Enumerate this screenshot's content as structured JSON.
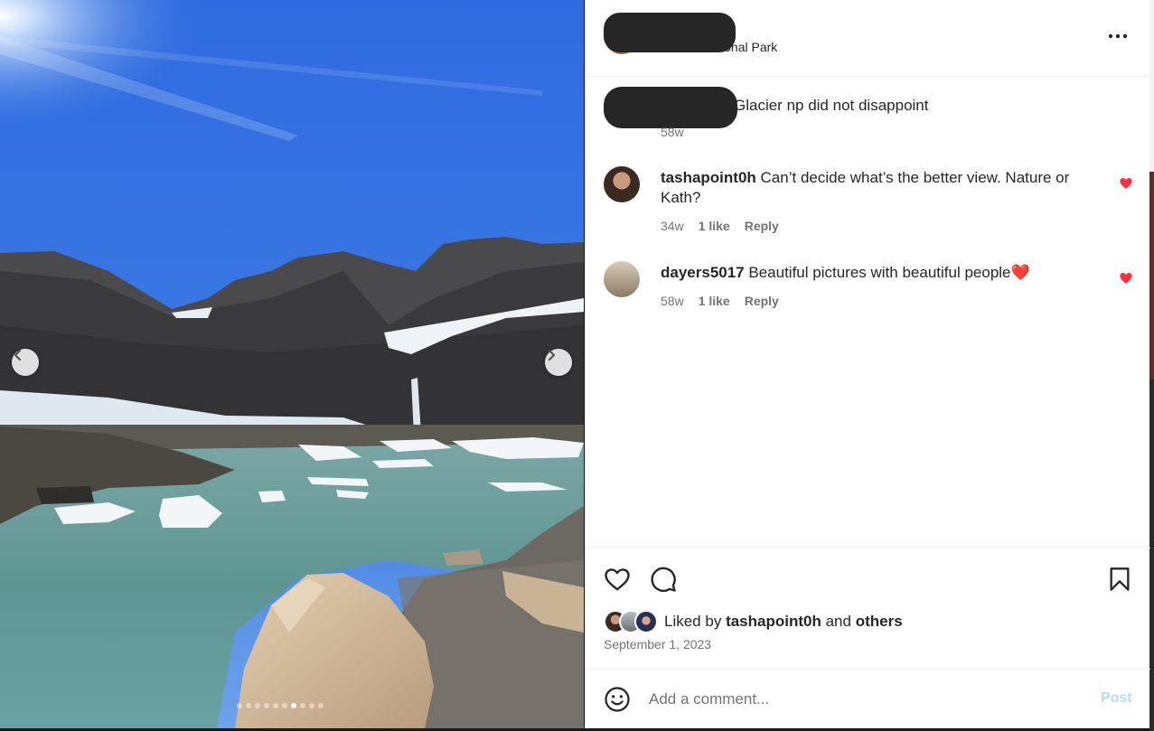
{
  "post": {
    "location": "Glacier National Park",
    "more_icon": "more-horizontal-icon"
  },
  "photo": {
    "alt": "Glacier lake with icebergs beneath mountain cliffs",
    "carousel_total": 10,
    "carousel_active": 7
  },
  "caption": {
    "text": "Glacier np did not disappoint",
    "time": "58w"
  },
  "comments": [
    {
      "username": "tashapoint0h",
      "text": "Can’t decide what’s the better view. Nature or Kath?",
      "time": "34w",
      "likes": "1 like",
      "reply": "Reply",
      "liked": true
    },
    {
      "username": "dayers5017",
      "text": "Beautiful pictures with beautiful people❤️",
      "time": "58w",
      "likes": "1 like",
      "reply": "Reply",
      "liked": true
    }
  ],
  "likes": {
    "prefix": "Liked by",
    "user": "tashapoint0h",
    "and": "and",
    "others": "others"
  },
  "date": "September 1, 2023",
  "add_comment": {
    "placeholder": "Add a comment...",
    "post_label": "Post"
  },
  "colors": {
    "heart_red": "#ff3040",
    "post_disabled": "#b3dbff",
    "text": "#262626",
    "secondary": "#737373"
  }
}
